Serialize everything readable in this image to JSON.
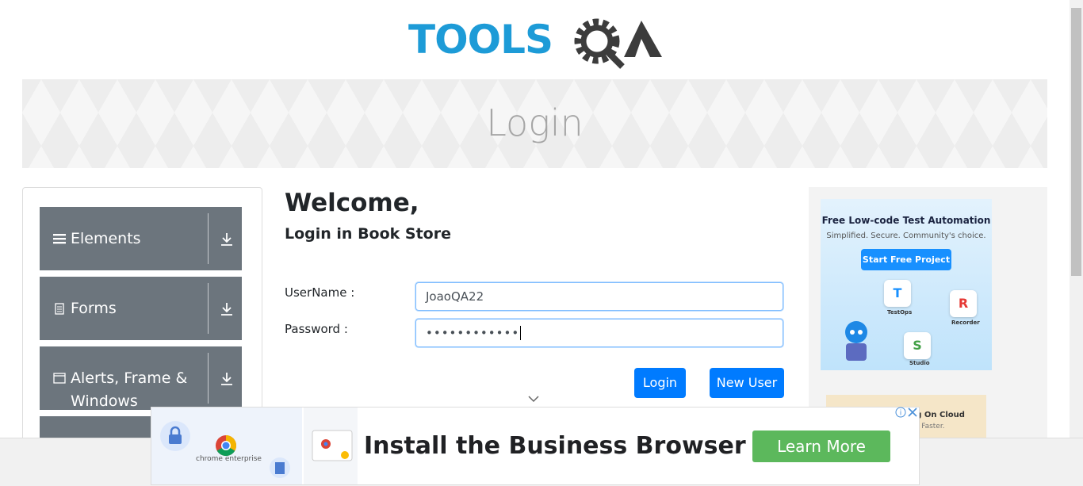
{
  "logo": {
    "text_left": "TOOLS",
    "text_right": "QA"
  },
  "header": {
    "title": "Login"
  },
  "sidebar": {
    "groups": [
      {
        "label": "Elements",
        "icon": "hamburger-icon"
      },
      {
        "label": "Forms",
        "icon": "document-icon"
      },
      {
        "label": "Alerts, Frame & Windows",
        "icon": "window-icon"
      }
    ]
  },
  "main": {
    "welcome": "Welcome,",
    "subtitle": "Login in Book Store",
    "username_label": "UserName :",
    "username_value": "JoaoQA22",
    "password_label": "Password :",
    "password_value": "••••••••••••",
    "login_button": "Login",
    "new_user_button": "New User"
  },
  "ad_right": {
    "title": "Free Low-code Test Automation",
    "tagline": "Simplified. Secure. Community's choice.",
    "cta": "Start Free Project",
    "labels": [
      "TestOps",
      "Recorder",
      "Studio"
    ],
    "lower_title": "sting On Cloud",
    "lower_sub": ". Ship Faster."
  },
  "ad_bottom": {
    "headline": "Install the Business Browser",
    "button": "Learn More",
    "brand": "chrome enterprise"
  },
  "colors": {
    "brand_blue": "#1d9bd7",
    "sidebar": "#6c757d",
    "primary": "#007bff",
    "ad_green": "#5cb85c"
  }
}
